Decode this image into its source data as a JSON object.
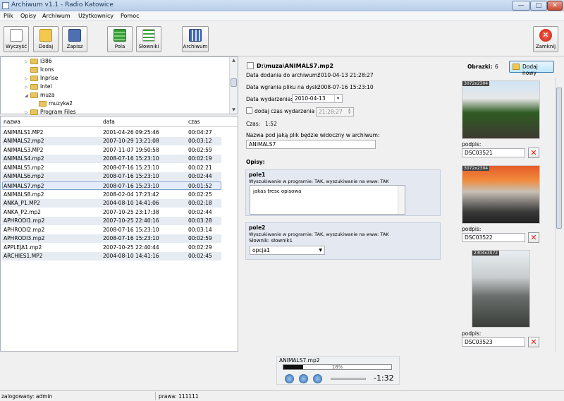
{
  "window": {
    "title": "Archiwum v1.1 - Radio Katowice",
    "min": "—",
    "max": "□",
    "close": "✕"
  },
  "menu": [
    "Plik",
    "Opisy",
    "Archiwum",
    "Użytkownicy",
    "Pomoc"
  ],
  "toolbar": {
    "clear": "Wyczyść",
    "add": "Dodaj",
    "save": "Zapisz",
    "fields": "Pola",
    "dicts": "Słowniki",
    "archive": "Archiwum",
    "close": "Zamknij"
  },
  "tree": [
    {
      "label": "I386",
      "level": 1,
      "expanded": false
    },
    {
      "label": "Icons",
      "level": 1,
      "expanded": false
    },
    {
      "label": "Inprise",
      "level": 1,
      "expanded": false
    },
    {
      "label": "Intel",
      "level": 1,
      "expanded": false
    },
    {
      "label": "muza",
      "level": 1,
      "expanded": true
    },
    {
      "label": "muzyka2",
      "level": 2,
      "expanded": false
    },
    {
      "label": "Program Files",
      "level": 1,
      "expanded": false
    }
  ],
  "files": {
    "headers": {
      "name": "nazwa",
      "date": "data",
      "time": "czas"
    },
    "rows": [
      {
        "name": "ANIMALS1.MP2",
        "date": "2001-04-26 09:25:46",
        "time": "00:04:27"
      },
      {
        "name": "ANIMALS2.mp2",
        "date": "2007-10-29 13:21:08",
        "time": "00:03:12"
      },
      {
        "name": "ANIMALS3.MP2",
        "date": "2007-11-07 19:50:58",
        "time": "00:02:59"
      },
      {
        "name": "ANIMALS4.mp2",
        "date": "2008-07-16 15:23:10",
        "time": "00:02:19"
      },
      {
        "name": "ANIMALS5.mp2",
        "date": "2008-07-16 15:23:10",
        "time": "00:02:21"
      },
      {
        "name": "ANIMALS6.mp2",
        "date": "2008-07-16 15:23:10",
        "time": "00:02:44"
      },
      {
        "name": "ANIMALS7.mp2",
        "date": "2008-07-16 15:23:10",
        "time": "00:01:52"
      },
      {
        "name": "ANIMALS8.mp2",
        "date": "2008-02-04 17:23:42",
        "time": "00:02:25"
      },
      {
        "name": "ANKA_P1.MP2",
        "date": "2004-08-10 14:41:06",
        "time": "00:02:18"
      },
      {
        "name": "ANKA_P2.mp2",
        "date": "2007-10-25 23:17:38",
        "time": "00:02:44"
      },
      {
        "name": "APHRODI1.mp2",
        "date": "2007-10-25 22:40:16",
        "time": "00:03:28"
      },
      {
        "name": "APHRODI2.mp2",
        "date": "2008-07-16 15:23:10",
        "time": "00:03:14"
      },
      {
        "name": "APHRODI3.mp2",
        "date": "2008-07-16 15:23:10",
        "time": "00:02:59"
      },
      {
        "name": "APPLEJA1.mp2",
        "date": "2007-10-25 22:40:44",
        "time": "00:02:29"
      },
      {
        "name": "ARCHIES1.MP2",
        "date": "2004-08-10 14:41:16",
        "time": "00:02:45"
      }
    ]
  },
  "detail": {
    "path": "D:\\muza\\ANIMALS7.mp2",
    "added_label": "Data dodania do archiwum:",
    "added": "2010-04-13 21:28:27",
    "uploaded_label": "Data wgrania pliku na dysk:",
    "uploaded": "2008-07-16 15:23:10",
    "event_label": "Data wydarzenia:",
    "event_date": "2010-04-13",
    "add_time_label": "dodaj czas wydarzenia",
    "event_time": "21:28:27",
    "duration_label": "Czas:",
    "duration": "1:52",
    "name_label": "Nazwa pod jaką plik będzie widoczny w archiwum:",
    "name_value": "ANIMALS7",
    "descriptions_label": "Opisy:",
    "pole1": {
      "title": "pole1",
      "info": "Wyszukiwanie w programie: TAK, wyszukiwanie na www: TAK",
      "text": "jakas tresc opisowa"
    },
    "pole2": {
      "title": "pole2",
      "info": "Wyszukiwanie w programie: TAK, wyszukiwanie na www: TAK",
      "dict": "Słownik: słownik1",
      "selected": "opcja1"
    }
  },
  "images": {
    "label": "Obrazki:",
    "count": "6",
    "add_button": "Dodaj nowy",
    "caption_label": "podpis:",
    "items": [
      {
        "dims": "3072x2304",
        "caption": "DSC03521"
      },
      {
        "dims": "3072x2304",
        "caption": "DSC03522"
      },
      {
        "dims": "2304x3072",
        "caption": "DSC03523"
      }
    ]
  },
  "player": {
    "track": "ANIMALS7.mp2",
    "progress": "18%",
    "progress_value": 18,
    "remaining": "-1:32"
  },
  "status": {
    "user": "zalogowany: admin",
    "rights": "prawa: 111111"
  }
}
